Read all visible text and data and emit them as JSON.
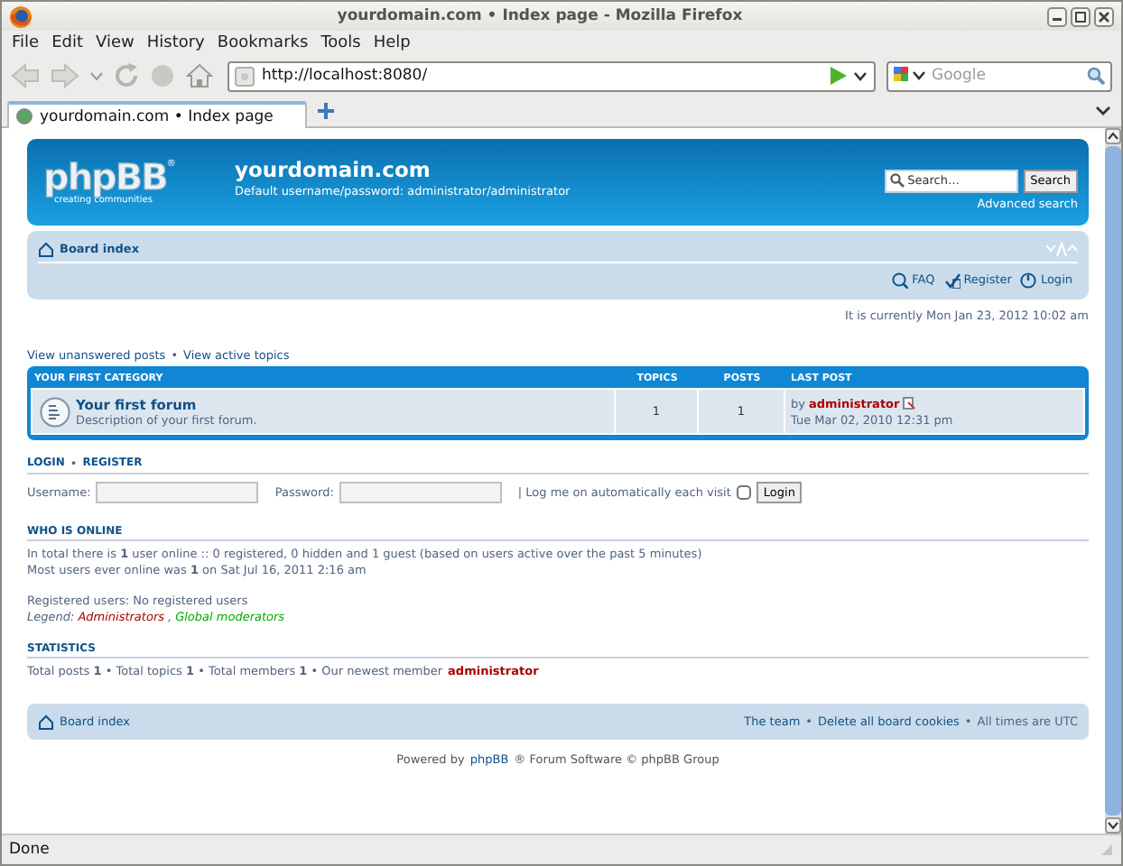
{
  "window": {
    "title": "yourdomain.com • Index page - Mozilla Firefox"
  },
  "menu": [
    "File",
    "Edit",
    "View",
    "History",
    "Bookmarks",
    "Tools",
    "Help"
  ],
  "address": {
    "value": "http://localhost:8080/"
  },
  "web_search": {
    "placeholder": "Google"
  },
  "tabs": [
    {
      "label": "yourdomain.com • Index page",
      "selected": true
    }
  ],
  "page": {
    "logo": {
      "name": "phpBB",
      "mark": "®",
      "tagline": "creating communities"
    },
    "site_title": "yourdomain.com",
    "site_description": "Default username/password: administrator/administrator",
    "search": {
      "placeholder": "Search…",
      "button": "Search",
      "advanced": "Advanced search"
    },
    "breadcrumb": "Board index",
    "nav_links": [
      {
        "kind": "faq",
        "label": "FAQ"
      },
      {
        "kind": "register",
        "label": "Register"
      },
      {
        "kind": "login",
        "label": "Login"
      }
    ],
    "current_time": "It is currently Mon Jan 23, 2012 10:02 am",
    "top_links": [
      "View unanswered posts",
      "View active topics"
    ],
    "separator": "•",
    "category": {
      "title": "YOUR FIRST CATEGORY",
      "columns": [
        "TOPICS",
        "POSTS",
        "LAST POST"
      ],
      "forums": [
        {
          "name": "Your first forum",
          "description": "Description of your first forum.",
          "topics": "1",
          "posts": "1",
          "last_post_prefix": "by",
          "last_post_user": "administrator",
          "last_post_time": "Tue Mar 02, 2010 12:31 pm"
        }
      ]
    },
    "login": {
      "heading": "LOGIN",
      "heading_2": "REGISTER",
      "username_label": "Username:",
      "password_label": "Password:",
      "remember_label": "| Log me on automatically each visit",
      "remember_checked": false,
      "button": "Login"
    },
    "who_is_online": {
      "heading": "WHO IS ONLINE",
      "lines": [
        "In total there is **1** user online :: 0 registered, 0 hidden and 1 guest (based on users active over the past 5 minutes)",
        "Most users ever online was **1** on Sat Jul 16, 2011 2:16 am"
      ],
      "registered": "Registered users: No registered users",
      "legend_label": "Legend:",
      "groups": [
        {
          "name": "Administrators",
          "color": "#aa0000"
        },
        {
          "name": "Global moderators",
          "color": "#00aa00"
        }
      ],
      "group_separator": ","
    },
    "statistics": {
      "heading": "STATISTICS",
      "text": "Total posts **1** • Total topics **1** • Total members **1** • Our newest member",
      "newest_member": "administrator"
    },
    "footer": {
      "breadcrumb": "Board index",
      "links": [
        "The team",
        "Delete all board cookies"
      ],
      "note": "All times are UTC"
    },
    "powered": {
      "prefix": "Powered by",
      "link": "phpBB",
      "suffix": "® Forum Software © phpBB Group"
    }
  },
  "status_bar": "Done"
}
